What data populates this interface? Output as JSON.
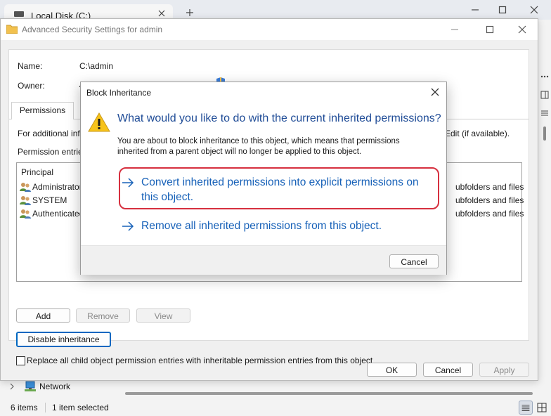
{
  "explorer": {
    "tab_title": "Local Disk (C:)",
    "nav_network": "Network",
    "status_items": "6 items",
    "status_selected": "1 item selected"
  },
  "adv_window": {
    "title": "Advanced Security Settings for admin",
    "name_label": "Name:",
    "name_value": "C:\\admin",
    "owner_label": "Owner:",
    "tab_permissions": "Permissions",
    "info_text": "For additional information",
    "info_right": "Edit (if available).",
    "entries_label": "Permission entries:",
    "principal_header": "Principal",
    "rows": [
      {
        "principal": "Administrators",
        "applies": "ubfolders and files"
      },
      {
        "principal": "SYSTEM",
        "applies": "ubfolders and files"
      },
      {
        "principal": "Authenticated Users",
        "applies": "ubfolders and files"
      }
    ],
    "btn_add": "Add",
    "btn_remove": "Remove",
    "btn_view": "View",
    "btn_disable_inheritance": "Disable inheritance",
    "replace_checkbox_label": "Replace all child object permission entries with inheritable permission entries from this object",
    "btn_ok": "OK",
    "btn_cancel": "Cancel",
    "btn_apply": "Apply"
  },
  "dialog": {
    "title": "Block Inheritance",
    "question": "What would you like to do with the current inherited permissions?",
    "description": "You are about to block inheritance to this object, which means that permissions inherited from a parent object will no longer be applied to this object.",
    "option_convert": "Convert inherited permissions into explicit permissions on this object.",
    "option_remove": "Remove all inherited permissions from this object.",
    "btn_cancel": "Cancel"
  },
  "colors": {
    "link_blue": "#1761b8",
    "question_blue": "#1e4b96",
    "annotation_red": "#d6303f"
  }
}
